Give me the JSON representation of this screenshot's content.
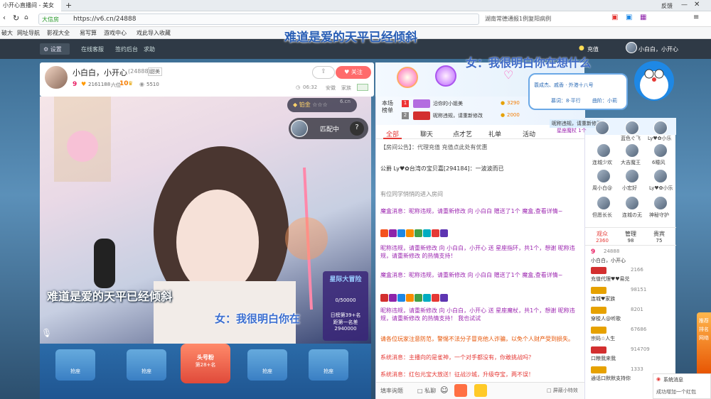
{
  "browser": {
    "tab_title": "小开心直播间 - 美女",
    "url_safety": "大信房",
    "url": "https://v6.cn/24888",
    "news_hint": "湖南常德通报1例复阳病例",
    "top_right": [
      "反馈"
    ],
    "bookmarks": [
      "破大",
      "网址导航",
      "影视大全",
      "易写算",
      "游戏中心",
      "戏此导入收藏"
    ]
  },
  "header": {
    "settings_label": "设置",
    "nav": [
      "在线客服",
      "签约后台",
      "求助"
    ],
    "recharge": "充值",
    "user": "小白白，小开心"
  },
  "anchor": {
    "name": "小白白，小开心",
    "room_id": "(24888)",
    "badge": "甜美",
    "level": "9",
    "followers": "2161188",
    "fans_label": "六位",
    "rich_level": "10",
    "coins": "5510",
    "time": "06:32",
    "place": "安徽",
    "family": "家族",
    "follow_label": "关注"
  },
  "gift_top": {
    "rank_title": "本场榜单",
    "rows": [
      {
        "name": "沿你的小姐美",
        "value": "3290"
      },
      {
        "name": "昵称违规，请重新修改",
        "value": "2000"
      }
    ]
  },
  "video": {
    "rank_badge": "铂金",
    "match_label": "匹配中",
    "event_title": "星际大冒险",
    "event_progress": "0/50000",
    "event_daily": "日榜第39+名",
    "event_gap": "距第一名差",
    "event_gap_value": "2940000",
    "room_num": "6.cn"
  },
  "seats": {
    "labels": [
      "抢座",
      "抢座",
      "",
      "抢座",
      "抢座"
    ],
    "center_title": "头号粉",
    "center_sub": "第28+名"
  },
  "chat": {
    "tabs": [
      "全部",
      "聊天",
      "点才艺",
      "礼单",
      "活动"
    ],
    "messages": [
      "【房间公告】：代理充值 充值点此处有优惠",
      "公爵 Ly♥✿台湾の宝贝嘉[294184]：一波波而已",
      "有位同学悄悄的进入房间",
      "魔盒消息：昵称违规，请重新修改 向 小白白 赠送了1个 魔盒,查看详情~",
      "昵称违规，请重新修改 向 小白白，小开心 送 星座指环，共1个，想谢 昵称违规，请重新修改 的热情支持！",
      "魔盒消息：昵称违规，请重新修改 向 小白白 赠送了1个 魔盒,查看详情~",
      "昵称违规，请重新修改 向 小白白，小开心 送 星座魔杖，共1个，想谢 昵称违规，请重新修改 的热情支持！ 我也试试",
      "请各位玩家注意防范，警惕不法分子冒充他人诈骗，以免个人财产受到损失。",
      "系统消息：主播向的是雀神，一个对手都没有，你敢挑战吗？",
      "系统消息：红包元宝大放送！征战沙城，升级夺宝，两不误！"
    ],
    "input_placeholder": "填率询题",
    "private_label": "私聊",
    "block_label": "屏蔽小特效"
  },
  "viewers": {
    "names": [
      "蓝色ぐ飞",
      "Ly♥✿小乐",
      "连城少欢",
      "大吉魔王",
      "6瞳风",
      "周小白@",
      "小宏好",
      "Ly♥✿小乐",
      "但愿长长",
      "连城の无",
      "神秘守护"
    ],
    "featured": "昵称违规，请重新修改",
    "featured_sub": "星座魔杖 1个"
  },
  "rank_panel": {
    "tabs": [
      {
        "label": "观众",
        "count": "2360"
      },
      {
        "label": "管理",
        "count": "98"
      },
      {
        "label": "贵宾",
        "count": "75"
      }
    ],
    "rows": [
      {
        "level": "9",
        "num": "24888",
        "name": "小白白，小开心"
      },
      {
        "level": "",
        "num": "2166",
        "name": "充值代理♥♥易兑"
      },
      {
        "level": "",
        "num": "98151",
        "name": "连城♥家族"
      },
      {
        "level": "",
        "num": "8201",
        "name": "穿梭人@听歌"
      },
      {
        "level": "",
        "num": "67686",
        "name": "宗码☆人生"
      },
      {
        "level": "",
        "num": "914709",
        "name": "口粮我来我"
      },
      {
        "level": "",
        "num": "1333",
        "name": "通话口默默支持你"
      }
    ]
  },
  "notice": {
    "line1": "蓑成杰、戚香 · 外港十八号",
    "line2": "慕词：8·平行",
    "line3": "曲阶：小莉"
  },
  "lyrics": {
    "line1": "难道是爱的天平已经倾斜",
    "line2": "女：我很明白你在想什么",
    "video_line1": "难道是爱的天平已经倾斜",
    "video_line2": "女：我很明白你在"
  },
  "popup": {
    "title": "系统消息",
    "text": "成功增加一个红包"
  },
  "side_tabs": [
    "推荐",
    "排名",
    "网络"
  ]
}
